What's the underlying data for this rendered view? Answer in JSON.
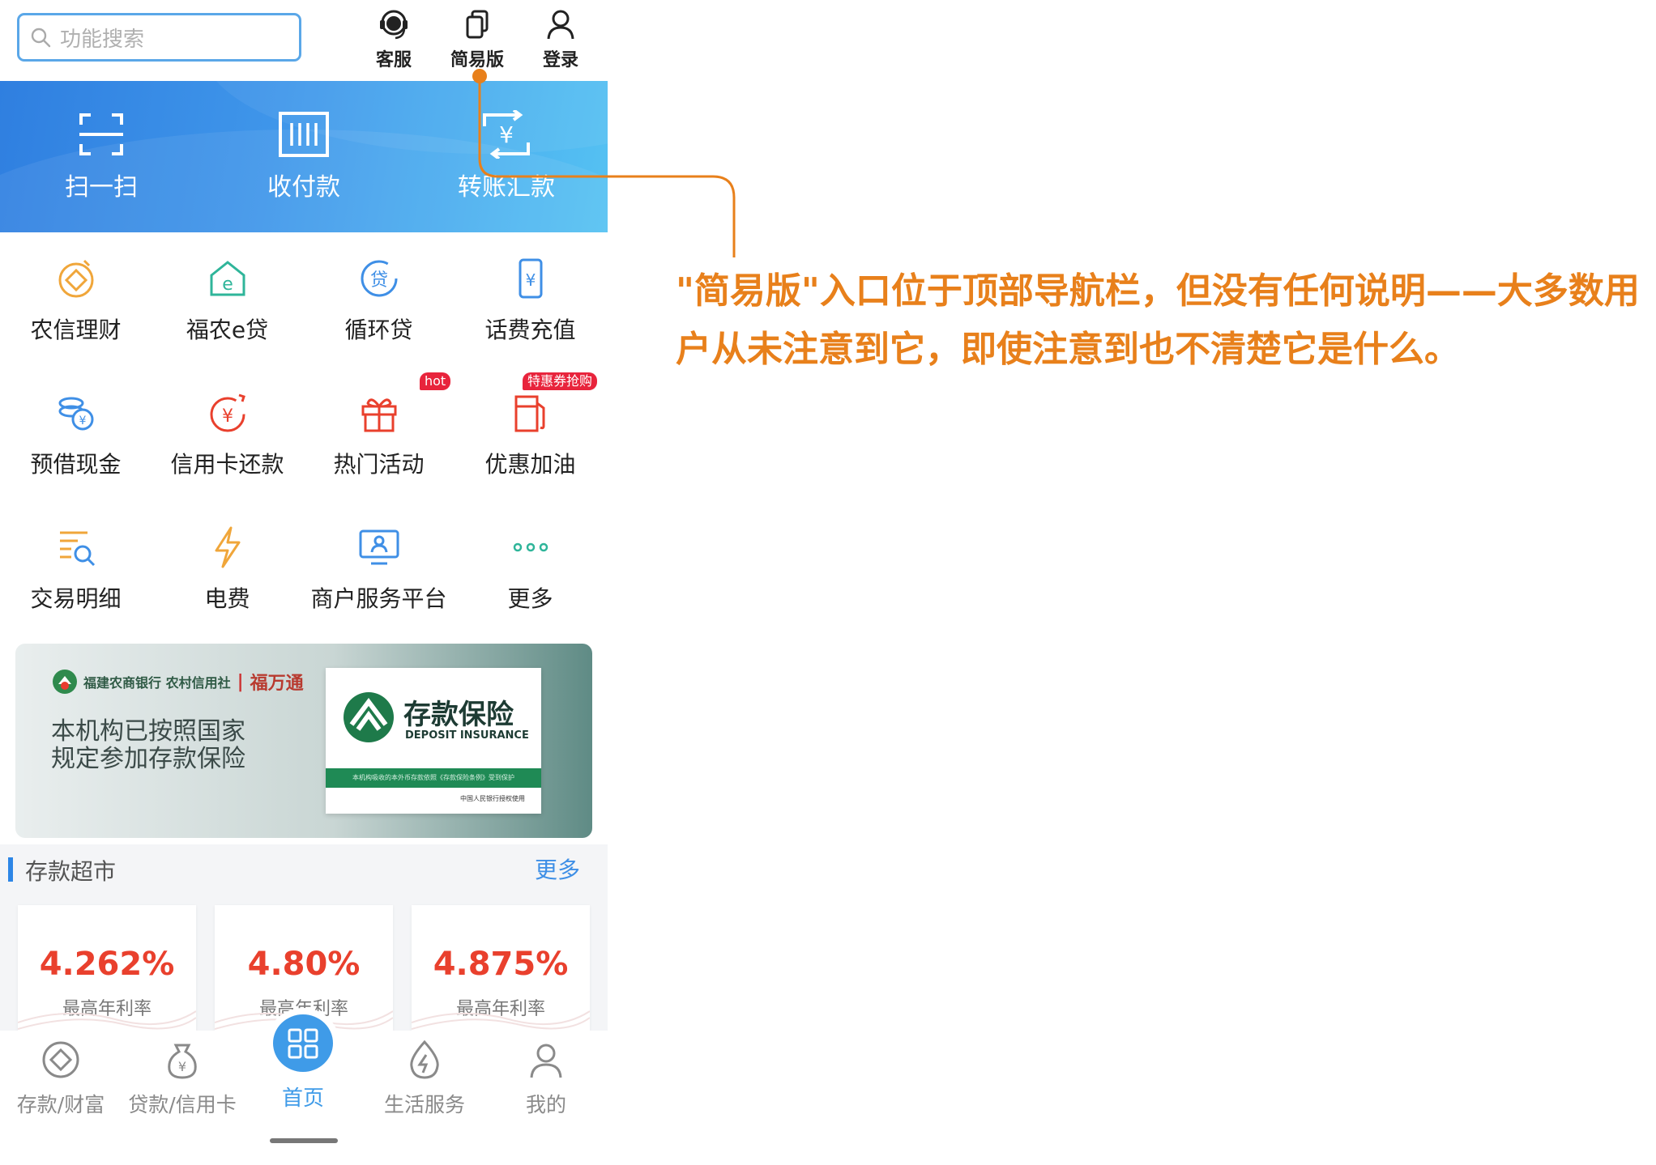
{
  "search": {
    "placeholder": "功能搜索"
  },
  "top_icons": {
    "service": "客服",
    "simple_mode": "简易版",
    "login": "登录"
  },
  "banner": {
    "scan": "扫一扫",
    "pay_receive": "收付款",
    "transfer": "转账汇款"
  },
  "grid": {
    "items": [
      {
        "label": "农信理财"
      },
      {
        "label": "福农e贷"
      },
      {
        "label": "循环贷"
      },
      {
        "label": "话费充值"
      },
      {
        "label": "预借现金"
      },
      {
        "label": "信用卡还款"
      },
      {
        "label": "热门活动"
      },
      {
        "label": "优惠加油"
      },
      {
        "label": "交易明细"
      },
      {
        "label": "电费"
      },
      {
        "label": "商户服务平台"
      },
      {
        "label": "更多"
      }
    ],
    "badge_hot": "hot",
    "badge_promo": "特惠券抢购"
  },
  "insurance": {
    "bank_name": "福建农商银行 农村信用社",
    "brand": "福万通",
    "notice_line1": "本机构已按照国家",
    "notice_line2": "规定参加存款保险",
    "card_title": "存款保险",
    "card_subtitle": "DEPOSIT INSURANCE",
    "card_strip": "本机构吸收的本外币存款依照《存款保险条例》受到保护",
    "card_footer": "中国人民银行授权使用"
  },
  "deposit_market": {
    "title": "存款超市",
    "more": "更多",
    "cards": [
      {
        "rate": "4.262%",
        "caption": "最高年利率"
      },
      {
        "rate": "4.80%",
        "caption": "最高年利率"
      },
      {
        "rate": "4.875%",
        "caption": "最高年利率"
      }
    ]
  },
  "bottom_nav": {
    "deposit": "存款/财富",
    "loan": "贷款/信用卡",
    "home": "首页",
    "life": "生活服务",
    "mine": "我的"
  },
  "annotation": {
    "text": "\"简易版\"入口位于顶部导航栏，但没有任何说明——大多数用户从未注意到它，即使注意到也不清楚它是什么。"
  },
  "colors": {
    "accent_blue": "#3f9be8",
    "annotation_orange": "#e8801b",
    "rate_red": "#e9402d",
    "badge_red": "#e8243c"
  }
}
